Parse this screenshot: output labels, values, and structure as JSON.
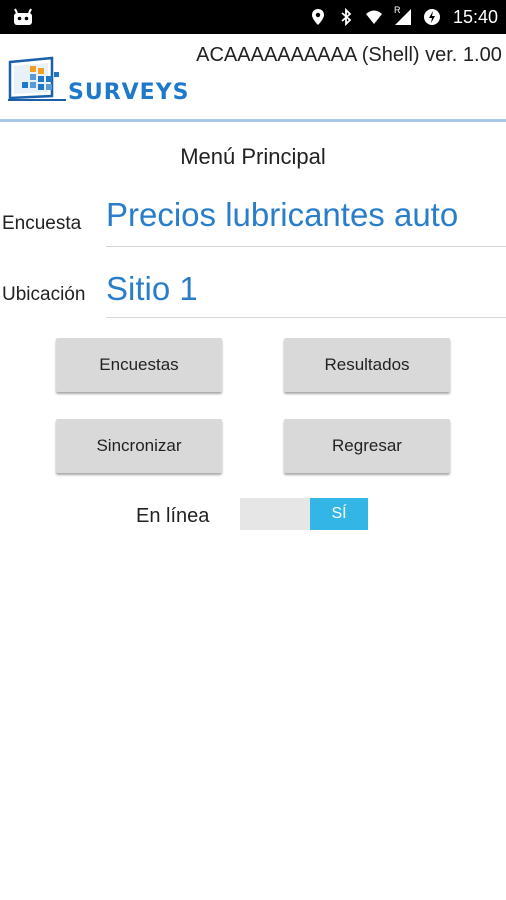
{
  "status_bar": {
    "time": "15:40",
    "icons": [
      "android-icon",
      "location-icon",
      "bluetooth-icon",
      "wifi-icon",
      "signal-roaming-icon",
      "data-saver-icon"
    ],
    "roaming_indicator": "R"
  },
  "header": {
    "logo_text": "SURVEYS",
    "app_title": "ACAAAAAAAAAA (Shell) ver. 1.00"
  },
  "main": {
    "title": "Menú Principal",
    "survey_label": "Encuesta",
    "survey_value": "Precios lubricantes auto",
    "location_label": "Ubicación",
    "location_value": "Sitio 1",
    "buttons": {
      "surveys": "Encuestas",
      "results": "Resultados",
      "sync": "Sincronizar",
      "back": "Regresar"
    },
    "online_label": "En línea",
    "online_toggle_value": "SÍ"
  },
  "colors": {
    "accent_blue": "#2a7ec9",
    "toggle_on": "#33b5e5",
    "button_bg": "#d9d9d9",
    "status_bar": "#000000"
  }
}
